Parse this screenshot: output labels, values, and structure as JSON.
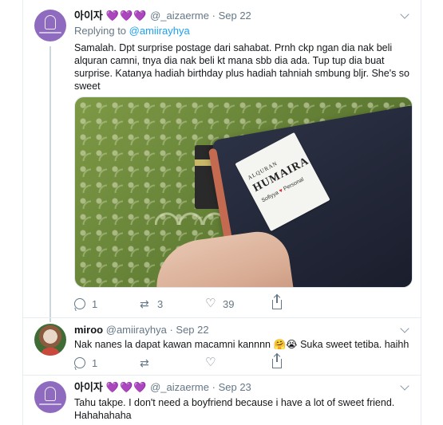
{
  "tweets": [
    {
      "name": "아이자",
      "hearts": "💜💜💜",
      "handle": "@_aizaerme",
      "separator": "·",
      "date": "Sep 22",
      "reply_prefix": "Replying to",
      "reply_handle": "@amiirayhya",
      "text": "Samalah. Dpt surprise postage dari sahabat. Prnh ckp ngan dia nak beli alquran camni, tnya dia nak beli kt mana sbb dia ada. Tup tup dia buat surprise. Katanya hadiah birthday plus hadiah tahniah smbung bljr. She's so sweet",
      "photo_label": {
        "line1": "ALQURAN",
        "line2": "HUMAIRA",
        "line3_a": "Sofiyya",
        "line3_b": "Personal"
      },
      "reply_count": "1",
      "retweet_count": "3",
      "like_count": "39"
    },
    {
      "name": "miroo",
      "handle": "@amiirayhya",
      "separator": "·",
      "date": "Sep 22",
      "text": "Nak nanes la dapat kawan macamni kannnn 🤗😭 Suka sweet tetiba. haihh",
      "reply_count": "1",
      "retweet_count": "",
      "like_count": ""
    },
    {
      "name": "아이자",
      "hearts": "💜💜💜",
      "handle": "@_aizaerme",
      "separator": "·",
      "date": "Sep 23",
      "text": "Tahu takpe. I don't need a boyfriend because i have a lot of sweet friend. Hahahahaha"
    }
  ],
  "colors": {
    "accent": "#1da1f2",
    "muted": "#657786",
    "heart": "#a87ee0"
  }
}
